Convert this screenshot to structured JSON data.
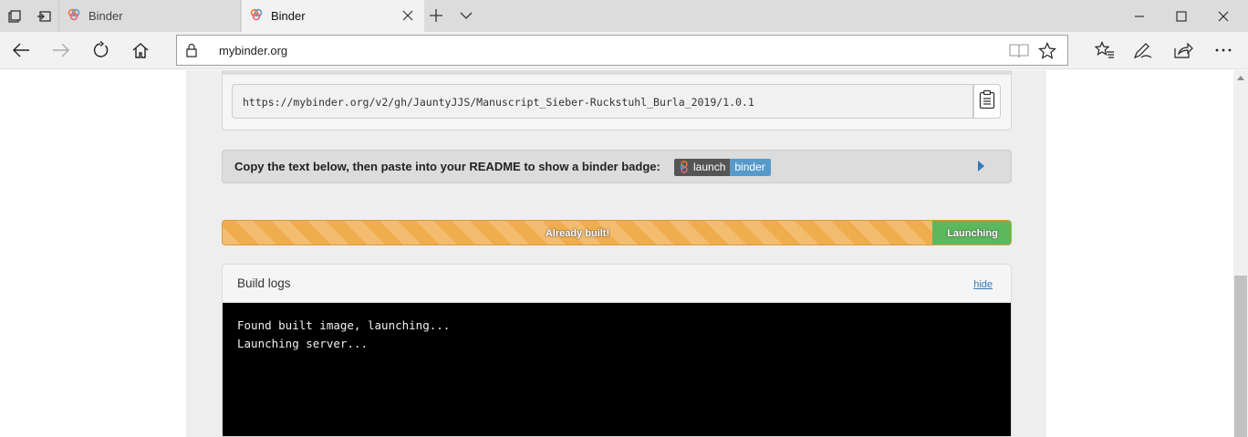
{
  "browser": {
    "tabs": [
      {
        "label": "Binder",
        "active": false
      },
      {
        "label": "Binder",
        "active": true
      }
    ],
    "address": "mybinder.org",
    "accent": "#dcdcdc"
  },
  "page": {
    "launch_url": "https://mybinder.org/v2/gh/JauntyJJS/Manuscript_Sieber-Ruckstuhl_Burla_2019/1.0.1",
    "badge_prompt": "Copy the text below, then paste into your README to show a binder badge:",
    "badge": {
      "left": "launch",
      "right": "binder",
      "left_color": "#555555",
      "right_color": "#579aca"
    },
    "progress": {
      "built_label": "Already built!",
      "launch_label": "Launching",
      "built_color": "#f0ad4e",
      "launch_color": "#5cb85c"
    },
    "logs": {
      "title": "Build logs",
      "hide_label": "hide",
      "lines": [
        "Found built image, launching...",
        "Launching server..."
      ]
    }
  }
}
